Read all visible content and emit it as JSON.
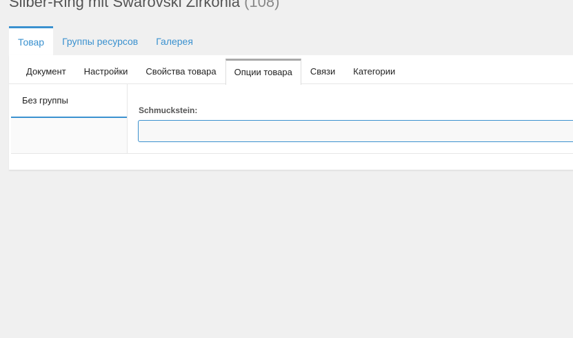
{
  "title": {
    "name": "Silber-Ring mit Swarovski Zirkonia",
    "count": "(108)"
  },
  "main_tabs": [
    {
      "label": "Товар",
      "active": true
    },
    {
      "label": "Группы ресурсов",
      "active": false
    },
    {
      "label": "Галерея",
      "active": false
    }
  ],
  "sub_tabs": [
    {
      "label": "Документ",
      "active": false
    },
    {
      "label": "Настройки",
      "active": false
    },
    {
      "label": "Свойства товара",
      "active": false
    },
    {
      "label": "Опции товара",
      "active": true
    },
    {
      "label": "Связи",
      "active": false
    },
    {
      "label": "Категории",
      "active": false
    }
  ],
  "groups": [
    {
      "label": "Без группы",
      "active": true
    }
  ],
  "field": {
    "label": "Schmuckstein:",
    "value": ""
  },
  "colors": {
    "accent": "#3a91cf",
    "background": "#f0f0f0",
    "panel": "#ffffff"
  }
}
